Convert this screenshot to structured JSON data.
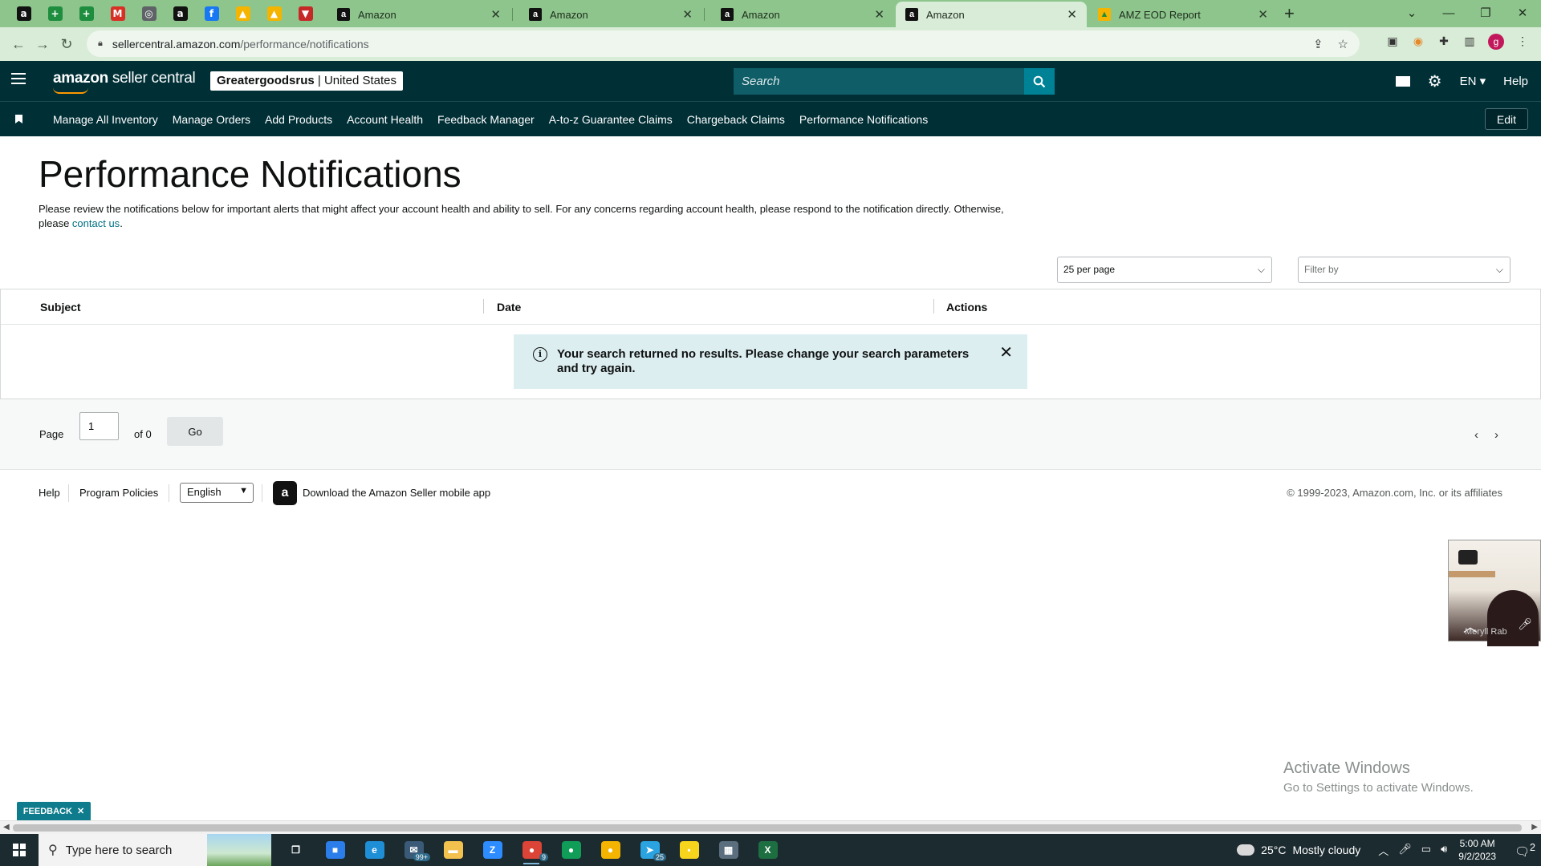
{
  "browser": {
    "pinned_tabs": [
      {
        "icon": "amazon-icon",
        "color": "#111111",
        "glyph": "a"
      },
      {
        "icon": "sheets-plus-icon",
        "color": "#1e8e3e",
        "glyph": "+"
      },
      {
        "icon": "sheets-plus-icon",
        "color": "#1e8e3e",
        "glyph": "+"
      },
      {
        "icon": "gmail-icon",
        "color": "#d93025",
        "glyph": "M"
      },
      {
        "icon": "globe-icon",
        "color": "#5f6368",
        "glyph": "◎"
      },
      {
        "icon": "amazon-icon",
        "color": "#111111",
        "glyph": "a"
      },
      {
        "icon": "facebook-icon",
        "color": "#1877f2",
        "glyph": "f"
      },
      {
        "icon": "drive-icon",
        "color": "#f4b400",
        "glyph": "▲"
      },
      {
        "icon": "drive-icon",
        "color": "#f4b400",
        "glyph": "▲"
      },
      {
        "icon": "shield-icon",
        "color": "#c62828",
        "glyph": "▼"
      }
    ],
    "tabs": [
      {
        "title": "Amazon",
        "active": false
      },
      {
        "title": "Amazon",
        "active": false
      },
      {
        "title": "Amazon",
        "active": false
      },
      {
        "title": "Amazon",
        "active": true
      },
      {
        "title": "AMZ EOD Report",
        "active": false
      }
    ],
    "url_host": "sellercentral.amazon.com",
    "url_path": "/performance/notifications",
    "profile_initial": "g"
  },
  "header": {
    "brand_bold": "amazon",
    "brand_rest": " seller central",
    "store_name": "Greatergoodsrus",
    "store_sep": " | ",
    "store_country": "United States",
    "search_placeholder": "Search",
    "lang": "EN",
    "help": "Help"
  },
  "nav": {
    "items": [
      "Manage All Inventory",
      "Manage Orders",
      "Add Products",
      "Account Health",
      "Feedback Manager",
      "A-to-z Guarantee Claims",
      "Chargeback Claims",
      "Performance Notifications"
    ],
    "edit": "Edit"
  },
  "page": {
    "title": "Performance Notifications",
    "intro": "Please review the notifications below for important alerts that might affect your account health and ability to sell. For any concerns regarding account health, please respond to the notification directly. Otherwise, please ",
    "intro_link": "contact us",
    "intro_end": ".",
    "per_page": "25 per page",
    "filter_placeholder": "Filter by"
  },
  "table": {
    "columns": [
      "Subject",
      "Date",
      "Actions"
    ],
    "empty_message": "Your search returned no results. Please change your search parameters and try again."
  },
  "pagination": {
    "page_label": "Page",
    "current_page": "1",
    "of_label": "of 0",
    "go_label": "Go"
  },
  "footer": {
    "help": "Help",
    "policies": "Program Policies",
    "language": "English",
    "app_text": "Download the Amazon Seller mobile app",
    "copyright": "© 1999-2023, Amazon.com, Inc. or its affiliates"
  },
  "video_overlay": {
    "name": "Meryll Rab"
  },
  "watermark": {
    "line1": "Activate Windows",
    "line2": "Go to Settings to activate Windows."
  },
  "feedback_tab": "FEEDBACK",
  "taskbar": {
    "search_placeholder": "Type here to search",
    "apps": [
      {
        "icon": "task-view-icon",
        "color": "#1c2b30",
        "glyph": "❐",
        "badge": ""
      },
      {
        "icon": "store-icon",
        "color": "#2b7de9",
        "glyph": "■",
        "badge": ""
      },
      {
        "icon": "edge-icon",
        "color": "#1e8fd6",
        "glyph": "e",
        "badge": ""
      },
      {
        "icon": "mail-app-icon",
        "color": "#3a5a78",
        "glyph": "✉",
        "badge": "99+"
      },
      {
        "icon": "file-explorer-icon",
        "color": "#f2c14e",
        "glyph": "▬",
        "badge": ""
      },
      {
        "icon": "zoom-icon",
        "color": "#2d8cff",
        "glyph": "Z",
        "badge": ""
      },
      {
        "icon": "chrome-icon",
        "color": "#db4437",
        "glyph": "●",
        "badge": "9"
      },
      {
        "icon": "chrome-icon",
        "color": "#0f9d58",
        "glyph": "●",
        "badge": ""
      },
      {
        "icon": "chrome-icon",
        "color": "#f4b400",
        "glyph": "●",
        "badge": ""
      },
      {
        "icon": "telegram-icon",
        "color": "#2aa3e0",
        "glyph": "➤",
        "badge": "25"
      },
      {
        "icon": "sticky-notes-icon",
        "color": "#f7d51d",
        "glyph": "▪",
        "badge": ""
      },
      {
        "icon": "calculator-icon",
        "color": "#5a6e7d",
        "glyph": "▦",
        "badge": ""
      },
      {
        "icon": "excel-icon",
        "color": "#1d6f42",
        "glyph": "X",
        "badge": ""
      }
    ],
    "temperature": "25°C",
    "weather": "Mostly cloudy",
    "time": "5:00 AM",
    "date": "9/2/2023",
    "notification_count": "2"
  },
  "colors": {
    "tabstrip": "#8dc58c",
    "header_bg": "#002f36",
    "accent_teal": "#008296",
    "link": "#007185",
    "alert_bg": "#ddeef1"
  }
}
